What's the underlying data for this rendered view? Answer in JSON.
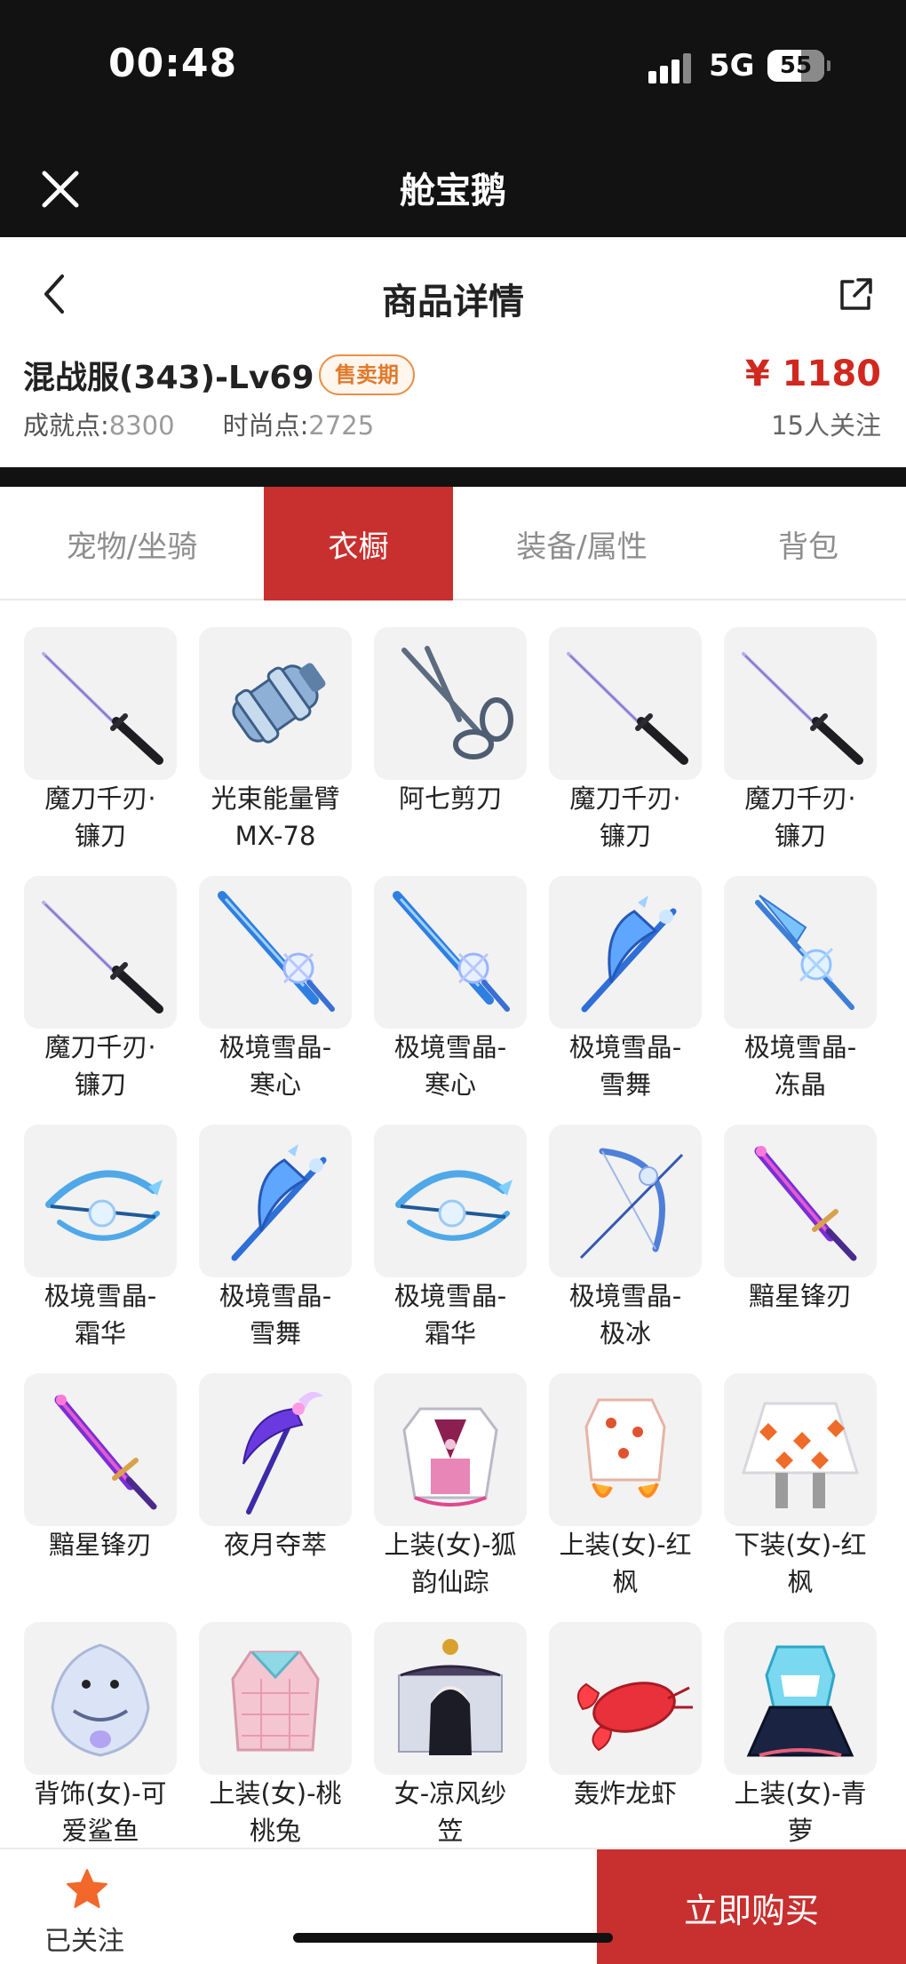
{
  "status_bar": {
    "time": "00:48",
    "network": "5G",
    "battery": "55",
    "battery_level": 0.55
  },
  "app_bar": {
    "title": "舱宝鹅",
    "close_icon": "close-icon"
  },
  "nav": {
    "title": "商品详情",
    "back_icon": "chevron-left-icon",
    "share_icon": "share-icon"
  },
  "product": {
    "name": "混战服(343)-Lv69",
    "badge": "售卖期",
    "price": "¥ 1180",
    "achievement_label": "成就点:",
    "achievement_value": "8300",
    "fashion_label": "时尚点:",
    "fashion_value": "2725",
    "followers": "15人关注"
  },
  "tabs": [
    {
      "label": "宠物/坐骑",
      "active": false
    },
    {
      "label": "衣橱",
      "active": true
    },
    {
      "label": "装备/属性",
      "active": false
    },
    {
      "label": "背包",
      "active": false
    }
  ],
  "items": [
    {
      "name": "魔刀千刃·镰刀",
      "lines": [
        "魔刀千刃·",
        "镰刀"
      ],
      "icon": "katana"
    },
    {
      "name": "光束能量臂MX-78",
      "lines": [
        "光束能量臂",
        "MX-78"
      ],
      "icon": "cannon"
    },
    {
      "name": "阿七剪刀",
      "lines": [
        "阿七剪刀"
      ],
      "icon": "scissors"
    },
    {
      "name": "魔刀千刃·镰刀",
      "lines": [
        "魔刀千刃·",
        "镰刀"
      ],
      "icon": "katana"
    },
    {
      "name": "魔刀千刃·镰刀",
      "lines": [
        "魔刀千刃·",
        "镰刀"
      ],
      "icon": "katana"
    },
    {
      "name": "魔刀千刃·镰刀",
      "lines": [
        "魔刀千刃·",
        "镰刀"
      ],
      "icon": "katana"
    },
    {
      "name": "极境雪晶-寒心",
      "lines": [
        "极境雪晶-",
        "寒心"
      ],
      "icon": "ice-sword"
    },
    {
      "name": "极境雪晶-寒心",
      "lines": [
        "极境雪晶-",
        "寒心"
      ],
      "icon": "ice-sword"
    },
    {
      "name": "极境雪晶-雪舞",
      "lines": [
        "极境雪晶-",
        "雪舞"
      ],
      "icon": "ice-scythe"
    },
    {
      "name": "极境雪晶-冻晶",
      "lines": [
        "极境雪晶-",
        "冻晶"
      ],
      "icon": "ice-spear"
    },
    {
      "name": "极境雪晶-霜华",
      "lines": [
        "极境雪晶-",
        "霜华"
      ],
      "icon": "ice-crossbow"
    },
    {
      "name": "极境雪晶-雪舞",
      "lines": [
        "极境雪晶-",
        "雪舞"
      ],
      "icon": "ice-scythe"
    },
    {
      "name": "极境雪晶-霜华",
      "lines": [
        "极境雪晶-",
        "霜华"
      ],
      "icon": "ice-crossbow"
    },
    {
      "name": "极境雪晶-极冰",
      "lines": [
        "极境雪晶-",
        "极冰"
      ],
      "icon": "ice-bow"
    },
    {
      "name": "黯星锋刃",
      "lines": [
        "黯星锋刃"
      ],
      "icon": "purple-blade"
    },
    {
      "name": "黯星锋刃",
      "lines": [
        "黯星锋刃"
      ],
      "icon": "purple-blade"
    },
    {
      "name": "夜月夺萃",
      "lines": [
        "夜月夺萃"
      ],
      "icon": "purple-scythe"
    },
    {
      "name": "上装(女)-狐韵仙踪",
      "lines": [
        "上装(女)-狐",
        "韵仙踪"
      ],
      "icon": "fox-top"
    },
    {
      "name": "上装(女)-红枫",
      "lines": [
        "上装(女)-红",
        "枫"
      ],
      "icon": "maple-top"
    },
    {
      "name": "下装(女)-红枫",
      "lines": [
        "下装(女)-红",
        "枫"
      ],
      "icon": "maple-skirt"
    },
    {
      "name": "背饰(女)-可爱鲨鱼",
      "lines": [
        "背饰(女)-可",
        "爱鲨鱼"
      ],
      "icon": "shark-backpack"
    },
    {
      "name": "上装(女)-桃桃兔",
      "lines": [
        "上装(女)-桃",
        "桃兔"
      ],
      "icon": "bunny-top"
    },
    {
      "name": "女-凉风纱笠",
      "lines": [
        "女-凉风纱",
        "笠"
      ],
      "icon": "veil-hat"
    },
    {
      "name": "轰炸龙虾",
      "lines": [
        "轰炸龙虾"
      ],
      "icon": "lobster"
    },
    {
      "name": "上装(女)-青萝",
      "lines": [
        "上装(女)-青",
        "萝"
      ],
      "icon": "teal-dress"
    }
  ],
  "bottom_bar": {
    "follow_label": "已关注",
    "follow_icon": "star-icon",
    "buy_label": "立即购买"
  },
  "colors": {
    "accent": "#c8302f",
    "price": "#d0281f",
    "badge": "#e07a2c",
    "dark": "#121212",
    "star": "#f2682a"
  }
}
